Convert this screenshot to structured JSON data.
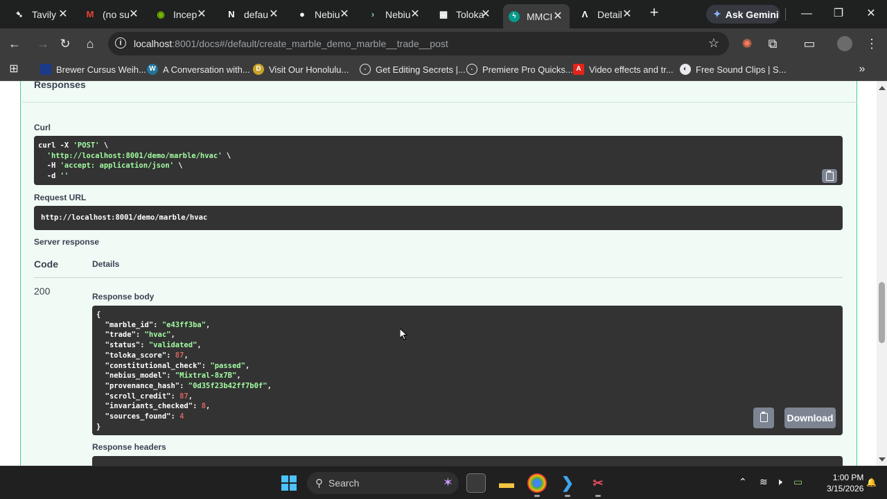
{
  "browser": {
    "tabs": [
      {
        "title": "Tavily",
        "icon": "tavily-icon"
      },
      {
        "title": "(no su",
        "icon": "gmail-icon"
      },
      {
        "title": "Incep",
        "icon": "nvidia-icon"
      },
      {
        "title": "defau",
        "icon": "docs-icon"
      },
      {
        "title": "Nebiu",
        "icon": "github-icon"
      },
      {
        "title": "Nebiu",
        "icon": "nebius-icon"
      },
      {
        "title": "Toloka",
        "icon": "toloka-icon"
      },
      {
        "title": "MMCI",
        "icon": "fastapi-icon"
      },
      {
        "title": "Detail",
        "icon": "detail-icon"
      }
    ],
    "ask_gemini": "Ask Gemini",
    "url_host": "localhost",
    "url_path": ":8001/docs#/default/create_marble_demo_marble__trade__post",
    "bookmarks": [
      "Brewer Cursus Weih...",
      "A Conversation with...",
      "Visit Our Honolulu...",
      "Get Editing Secrets |...",
      "Premiere Pro Quicks...",
      "Video effects and tr...",
      "Free Sound Clips | S..."
    ]
  },
  "page": {
    "responses_heading": "Responses",
    "curl_label": "Curl",
    "curl_line1_cmd": "curl -X ",
    "curl_line1_method": "'POST'",
    "curl_line1_end": " \\",
    "curl_line2_url": "'http://localhost:8001/demo/marble/hvac'",
    "curl_line2_end": " \\",
    "curl_line3_flag": "  -H ",
    "curl_line3_hdr": "'accept: application/json'",
    "curl_line3_end": " \\",
    "curl_line4_flag": "  -d ",
    "curl_line4_val": "''",
    "request_url_label": "Request URL",
    "request_url": "http://localhost:8001/demo/marble/hvac",
    "server_response_label": "Server response",
    "col_code": "Code",
    "col_details": "Details",
    "status_code": "200",
    "response_body_label": "Response body",
    "download_label": "Download",
    "response_headers_label": "Response headers",
    "response_body": [
      {
        "key": "marble_id",
        "value": "\"e43ff3ba\"",
        "type": "str"
      },
      {
        "key": "trade",
        "value": "\"hvac\"",
        "type": "str"
      },
      {
        "key": "status",
        "value": "\"validated\"",
        "type": "str"
      },
      {
        "key": "toloka_score",
        "value": "87",
        "type": "num"
      },
      {
        "key": "constitutional_check",
        "value": "\"passed\"",
        "type": "str"
      },
      {
        "key": "nebius_model",
        "value": "\"Mixtral-8x7B\"",
        "type": "str"
      },
      {
        "key": "provenance_hash",
        "value": "\"0d35f23b42ff7b0f\"",
        "type": "str"
      },
      {
        "key": "scroll_credit",
        "value": "87",
        "type": "num"
      },
      {
        "key": "invariants_checked",
        "value": "8",
        "type": "num"
      },
      {
        "key": "sources_found",
        "value": "4",
        "type": "num"
      }
    ]
  },
  "taskbar": {
    "search_placeholder": "Search",
    "time": "1:00 PM",
    "date": "3/15/2026"
  },
  "colors": {
    "success_border": "#49cc90",
    "code_bg": "#333333",
    "string_green": "#a2fca2",
    "number_red": "#d36363"
  }
}
